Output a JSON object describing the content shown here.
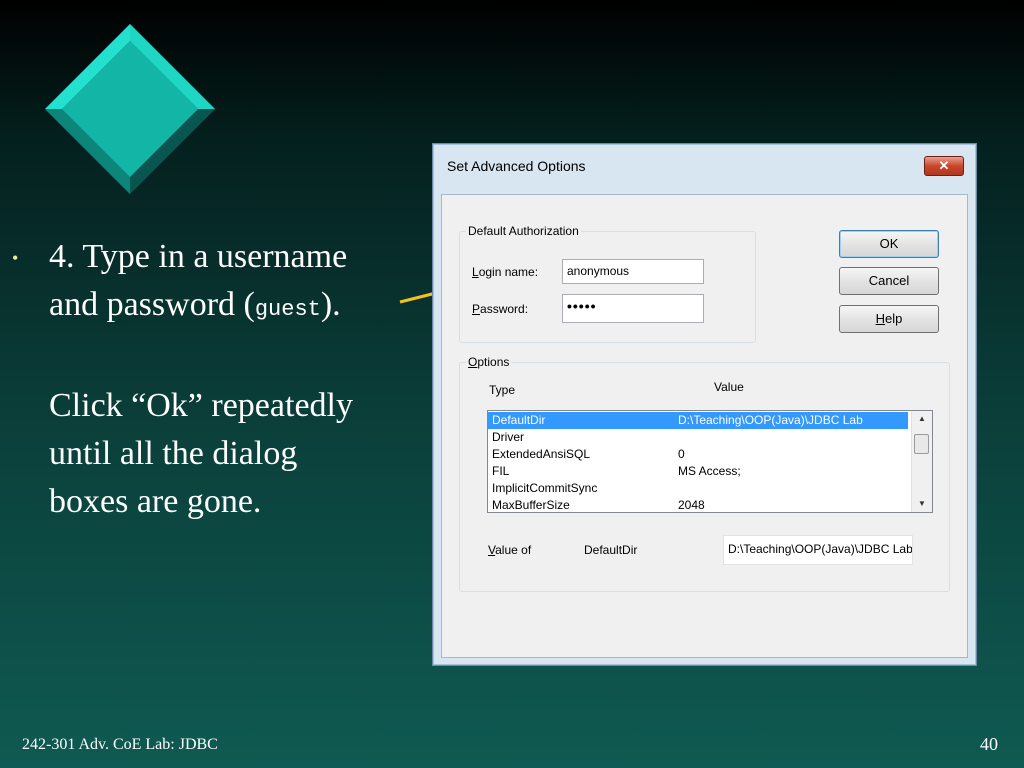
{
  "slide": {
    "bullet_line1": "4.  Type in a username",
    "bullet_line2_pre": "and password (",
    "bullet_line2_mono": "guest",
    "bullet_line2_post": ").",
    "bullet_para2_line1": "Click “Ok” repeatedly",
    "bullet_para2_line2": "until all the dialog",
    "bullet_para2_line3": "boxes are gone.",
    "footer_left": "242-301 Adv. CoE Lab: JDBC",
    "page_number": "40",
    "bullet_glyph": "•"
  },
  "dialog": {
    "title": "Set Advanced Options",
    "close_glyph": "✕",
    "auth_group_label": "Default Authorization",
    "login_label_u": "L",
    "login_label_rest": "ogin name:",
    "login_value": "anonymous",
    "password_label_u": "P",
    "password_label_rest": "assword:",
    "password_value": "•••••",
    "ok_label": "OK",
    "cancel_label": "Cancel",
    "help_label_u": "H",
    "help_label_rest": "elp",
    "options_group_u": "O",
    "options_group_rest": "ptions",
    "col_type": "Type",
    "col_value": "Value",
    "rows": [
      {
        "type": "DefaultDir",
        "value": "D:\\Teaching\\OOP(Java)\\JDBC Lab"
      },
      {
        "type": "Driver",
        "value": ""
      },
      {
        "type": "ExtendedAnsiSQL",
        "value": "0"
      },
      {
        "type": "FIL",
        "value": "MS Access;"
      },
      {
        "type": "ImplicitCommitSync",
        "value": ""
      },
      {
        "type": "MaxBufferSize",
        "value": "2048"
      }
    ],
    "value_of_u": "V",
    "value_of_rest": "alue of",
    "value_of_key": "DefaultDir",
    "value_of_value": "D:\\Teaching\\OOP(Java)\\JDBC Lab"
  },
  "colors": {
    "diamond": "#13b5a6",
    "arrow": "#f5c21b",
    "selection": "#3399ff"
  }
}
